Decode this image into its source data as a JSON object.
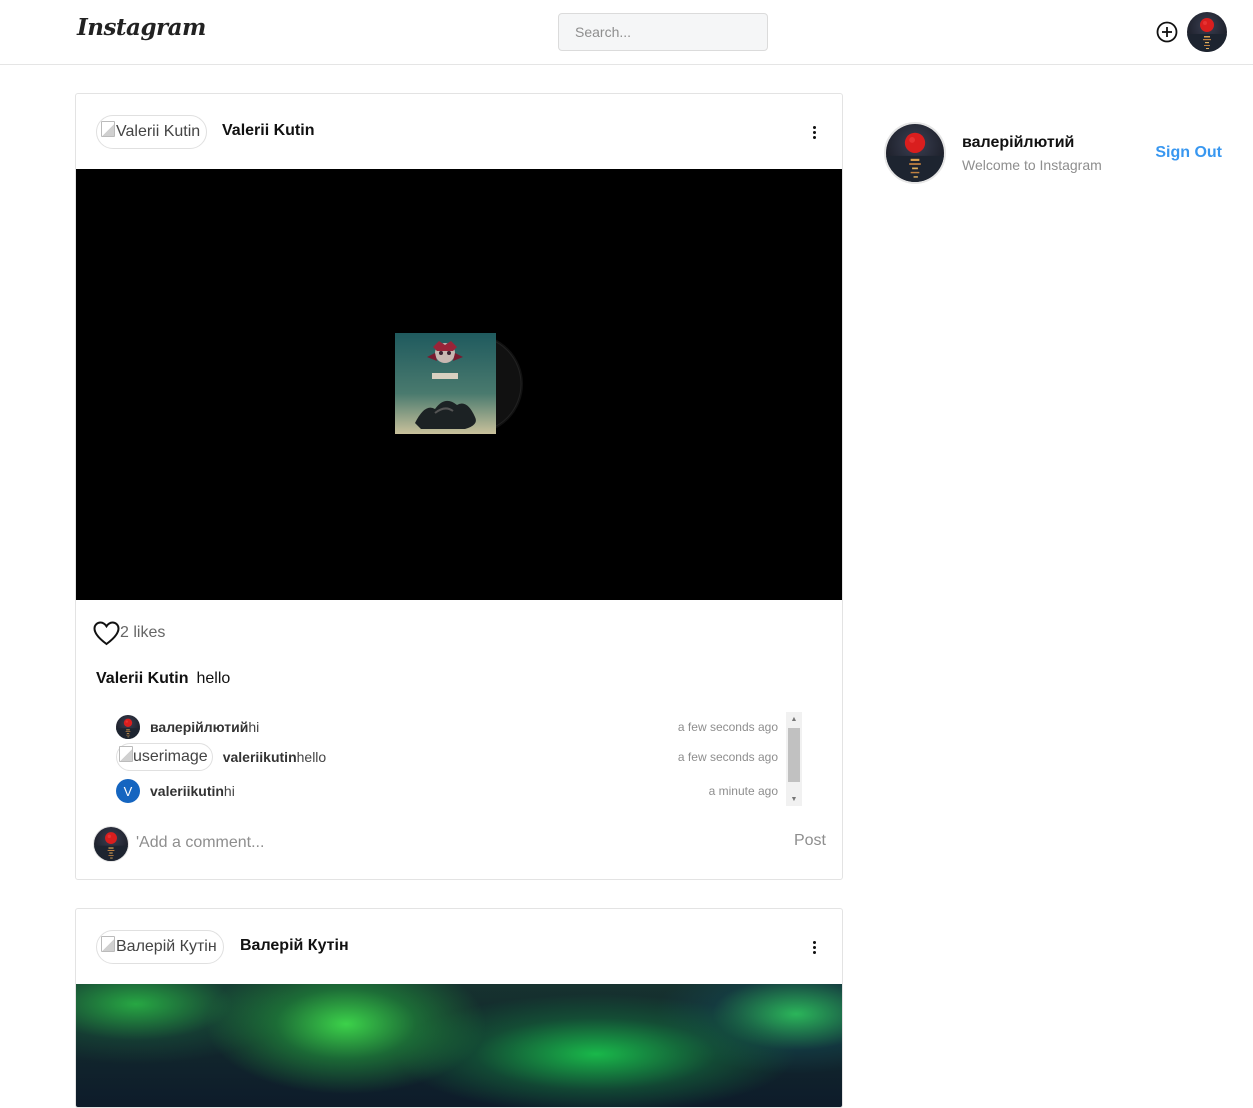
{
  "app": {
    "logo_text": "Instagram"
  },
  "header": {
    "search_placeholder": "Search...",
    "icons": {
      "add": "plus-circle-icon",
      "avatar": "user-avatar"
    }
  },
  "sidebar": {
    "username": "валерійлютий",
    "welcome": "Welcome to Instagram",
    "sign_out_label": "Sign Out"
  },
  "posts": [
    {
      "author": "Valerii Kutin",
      "avatar_alt": "Valerii Kutin",
      "likes": "2 likes",
      "caption_user": "Valerii Kutin",
      "caption_text": "hello",
      "comments": [
        {
          "user": "валерійлютий",
          "text": "hi",
          "time": "a few seconds ago",
          "avatar": "moon-avatar"
        },
        {
          "user": "valeriikutin",
          "text": "hello",
          "time": "a few seconds ago",
          "avatar_alt": "userimage"
        },
        {
          "user": "valeriikutin",
          "text": "hi",
          "time": "a minute ago",
          "avatar_letter": "V"
        }
      ],
      "add_comment_placeholder": "'Add a comment...",
      "post_label": "Post"
    },
    {
      "author": "Валерій Кутін",
      "avatar_alt": "Валерій Кутін"
    }
  ],
  "colors": {
    "link": "#3897f0",
    "border": "#e3e3e3",
    "badge": "#1565c0"
  }
}
